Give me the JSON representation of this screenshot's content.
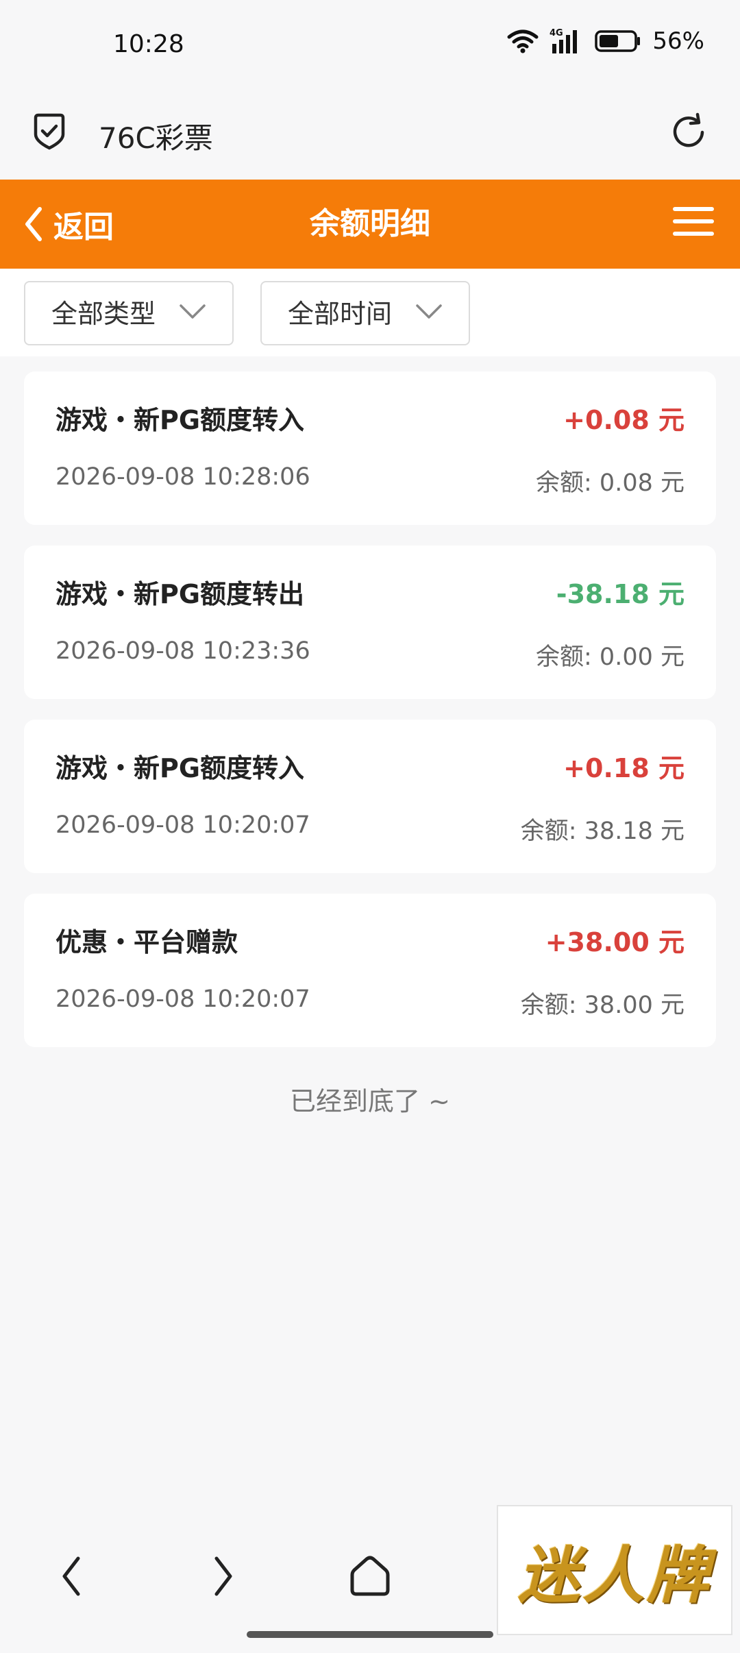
{
  "status_bar": {
    "time": "10:28",
    "network": "4G",
    "battery_pct": "56%",
    "battery_level": 0.56
  },
  "browser": {
    "title": "76C彩票"
  },
  "header": {
    "back_label": "返回",
    "title": "余额明细"
  },
  "filters": {
    "type_label": "全部类型",
    "time_label": "全部时间"
  },
  "transactions": [
    {
      "title": "游戏・新PG额度转入",
      "amount": "+0.08 元",
      "datetime": "2026-09-08 10:28:06",
      "balance": "余额: 0.08 元",
      "direction": "in"
    },
    {
      "title": "游戏・新PG额度转出",
      "amount": "-38.18 元",
      "datetime": "2026-09-08 10:23:36",
      "balance": "余额: 0.00 元",
      "direction": "out"
    },
    {
      "title": "游戏・新PG额度转入",
      "amount": "+0.18 元",
      "datetime": "2026-09-08 10:20:07",
      "balance": "余额: 38.18 元",
      "direction": "in"
    },
    {
      "title": "优惠・平台赠款",
      "amount": "+38.00 元",
      "datetime": "2026-09-08 10:20:07",
      "balance": "余额: 38.00 元",
      "direction": "in"
    }
  ],
  "end_text": "已经到底了 ~",
  "ad": {
    "text": "迷人牌"
  },
  "colors": {
    "accent": "#f57c09",
    "positive": "#d9413b",
    "negative": "#4caf71"
  }
}
